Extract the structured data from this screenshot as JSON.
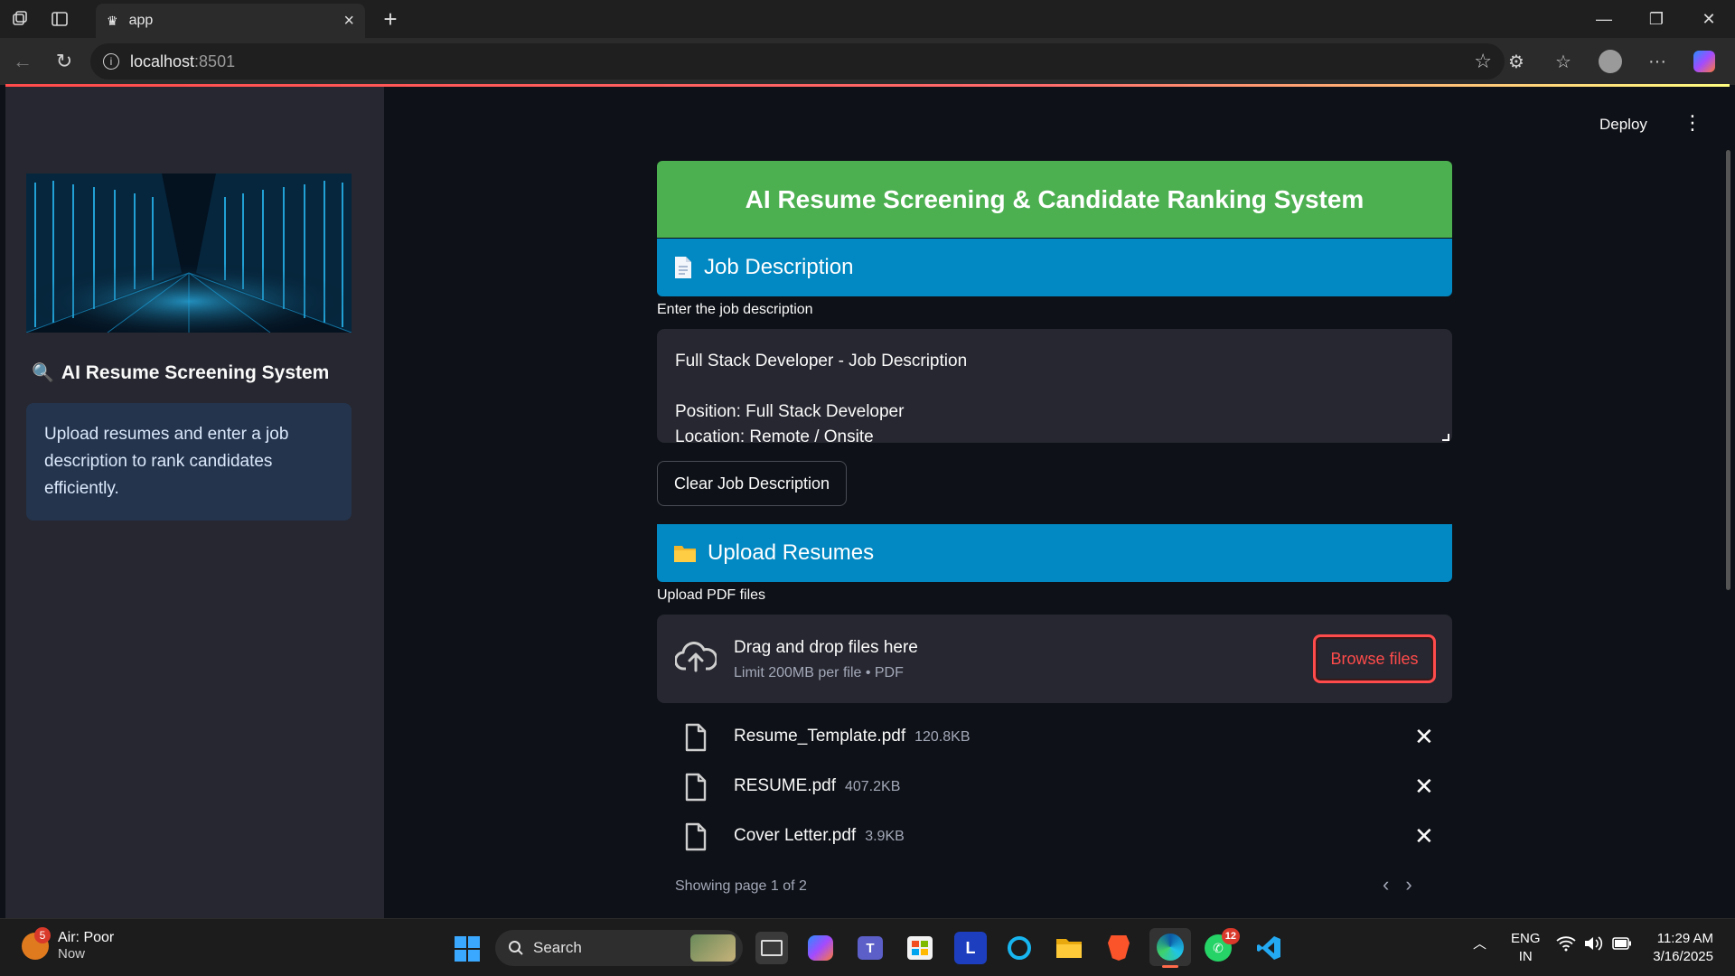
{
  "browser": {
    "tab_title": "app",
    "url_host": "localhost",
    "url_port": ":8501"
  },
  "sidebar": {
    "title": "AI Resume Screening System",
    "info": "Upload resumes and enter a job description to rank candidates efficiently."
  },
  "header": {
    "deploy_label": "Deploy"
  },
  "main": {
    "title": "AI Resume Screening & Candidate Ranking System",
    "job_section": "Job Description",
    "job_label": "Enter the job description",
    "job_text": "Full Stack Developer - Job Description\n\nPosition: Full Stack Developer\nLocation: Remote / Onsite",
    "clear_button": "Clear Job Description",
    "upload_section": "Upload Resumes",
    "upload_label": "Upload PDF files",
    "dropzone_main": "Drag and drop files here",
    "dropzone_sub": "Limit 200MB per file • PDF",
    "browse_button": "Browse files",
    "files": [
      {
        "name": "Resume_Template.pdf",
        "size": "120.8KB"
      },
      {
        "name": "RESUME.pdf",
        "size": "407.2KB"
      },
      {
        "name": "Cover Letter.pdf",
        "size": "3.9KB"
      }
    ],
    "pager": "Showing page 1 of 2"
  },
  "taskbar": {
    "weather_title": "Air: Poor",
    "weather_sub": "Now",
    "weather_badge": "5",
    "search_label": "Search",
    "whatsapp_badge": "12",
    "lang_top": "ENG",
    "lang_bottom": "IN",
    "time": "11:29 AM",
    "date": "3/16/2025"
  },
  "colors": {
    "title_green": "#4caf50",
    "section_blue": "#0288c2",
    "accent_red": "#ff4b4b",
    "sidebar_bg": "#262730",
    "main_bg": "#0e1117"
  }
}
